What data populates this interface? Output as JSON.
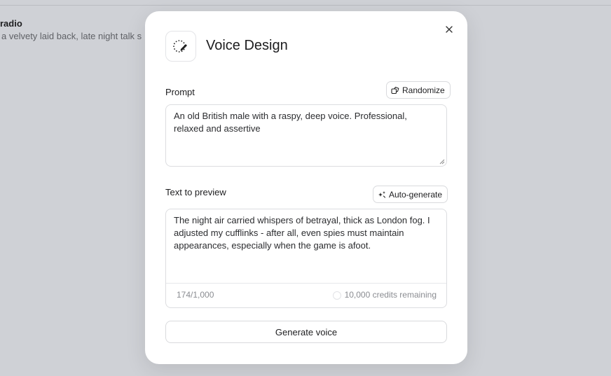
{
  "background": {
    "item_title": "radio",
    "item_description": "a velvety laid back, late night talk s"
  },
  "modal": {
    "title": "Voice Design",
    "header_icon": "voice-design-icon",
    "close_icon": "close-icon",
    "prompt": {
      "label": "Prompt",
      "randomize_label": "Randomize",
      "randomize_icon": "dice-icon",
      "value": "An old British male with a raspy, deep voice. Professional, relaxed and assertive"
    },
    "preview": {
      "label": "Text to preview",
      "autogen_label": "Auto-generate",
      "autogen_icon": "sparkle-icon",
      "value": "The night air carried whispers of betrayal, thick as London fog. I adjusted my cufflinks - after all, even spies must maintain appearances, especially when the game is afoot.",
      "char_count": "174/1,000",
      "credits": "10,000 credits remaining"
    },
    "generate_label": "Generate voice"
  }
}
